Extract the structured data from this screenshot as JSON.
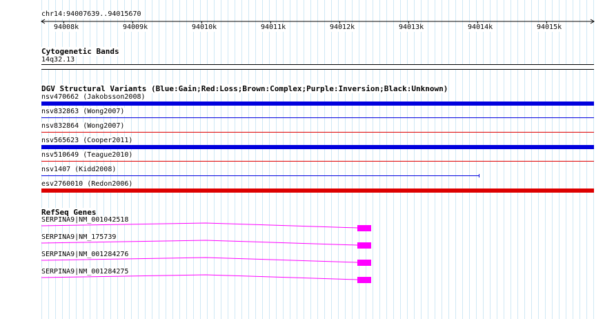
{
  "ruler": {
    "location": "chr14:94007639..94015670",
    "ticks": [
      "94008k",
      "94009k",
      "94010k",
      "94011k",
      "94012k",
      "94013k",
      "94014k",
      "94015k"
    ]
  },
  "cytoband": {
    "title": "Cytogenetic Bands",
    "band": "14q32.13"
  },
  "dgv": {
    "title": "DGV Structural Variants (Blue:Gain;Red:Loss;Brown:Complex;Purple:Inversion;Black:Unknown)",
    "variants": [
      {
        "label": "nsv470662 (Jakobsson2008)",
        "color": "#0000dd",
        "style": "thick"
      },
      {
        "label": "nsv832863 (Wong2007)",
        "color": "#0000dd",
        "style": "thin"
      },
      {
        "label": "nsv832864 (Wong2007)",
        "color": "#dd0000",
        "style": "thin"
      },
      {
        "label": "nsv565623 (Cooper2011)",
        "color": "#0000dd",
        "style": "thick"
      },
      {
        "label": "nsv510649 (Teague2010)",
        "color": "#dd0000",
        "style": "thin"
      },
      {
        "label": "nsv1407 (Kidd2008)",
        "color": "#0000dd",
        "style": "thin-partial"
      },
      {
        "label": "esv2760010 (Redon2006)",
        "color": "#dd0000",
        "style": "thick"
      }
    ]
  },
  "refseq": {
    "title": "RefSeq Genes",
    "genes": [
      {
        "label": "SERPINA9|NM_001042518",
        "color": "#ff00ff"
      },
      {
        "label": "SERPINA9|NM_175739",
        "color": "#ff00ff"
      },
      {
        "label": "SERPINA9|NM_001284276",
        "color": "#ff00ff"
      },
      {
        "label": "SERPINA9|NM_001284275",
        "color": "#ff00ff"
      }
    ]
  }
}
